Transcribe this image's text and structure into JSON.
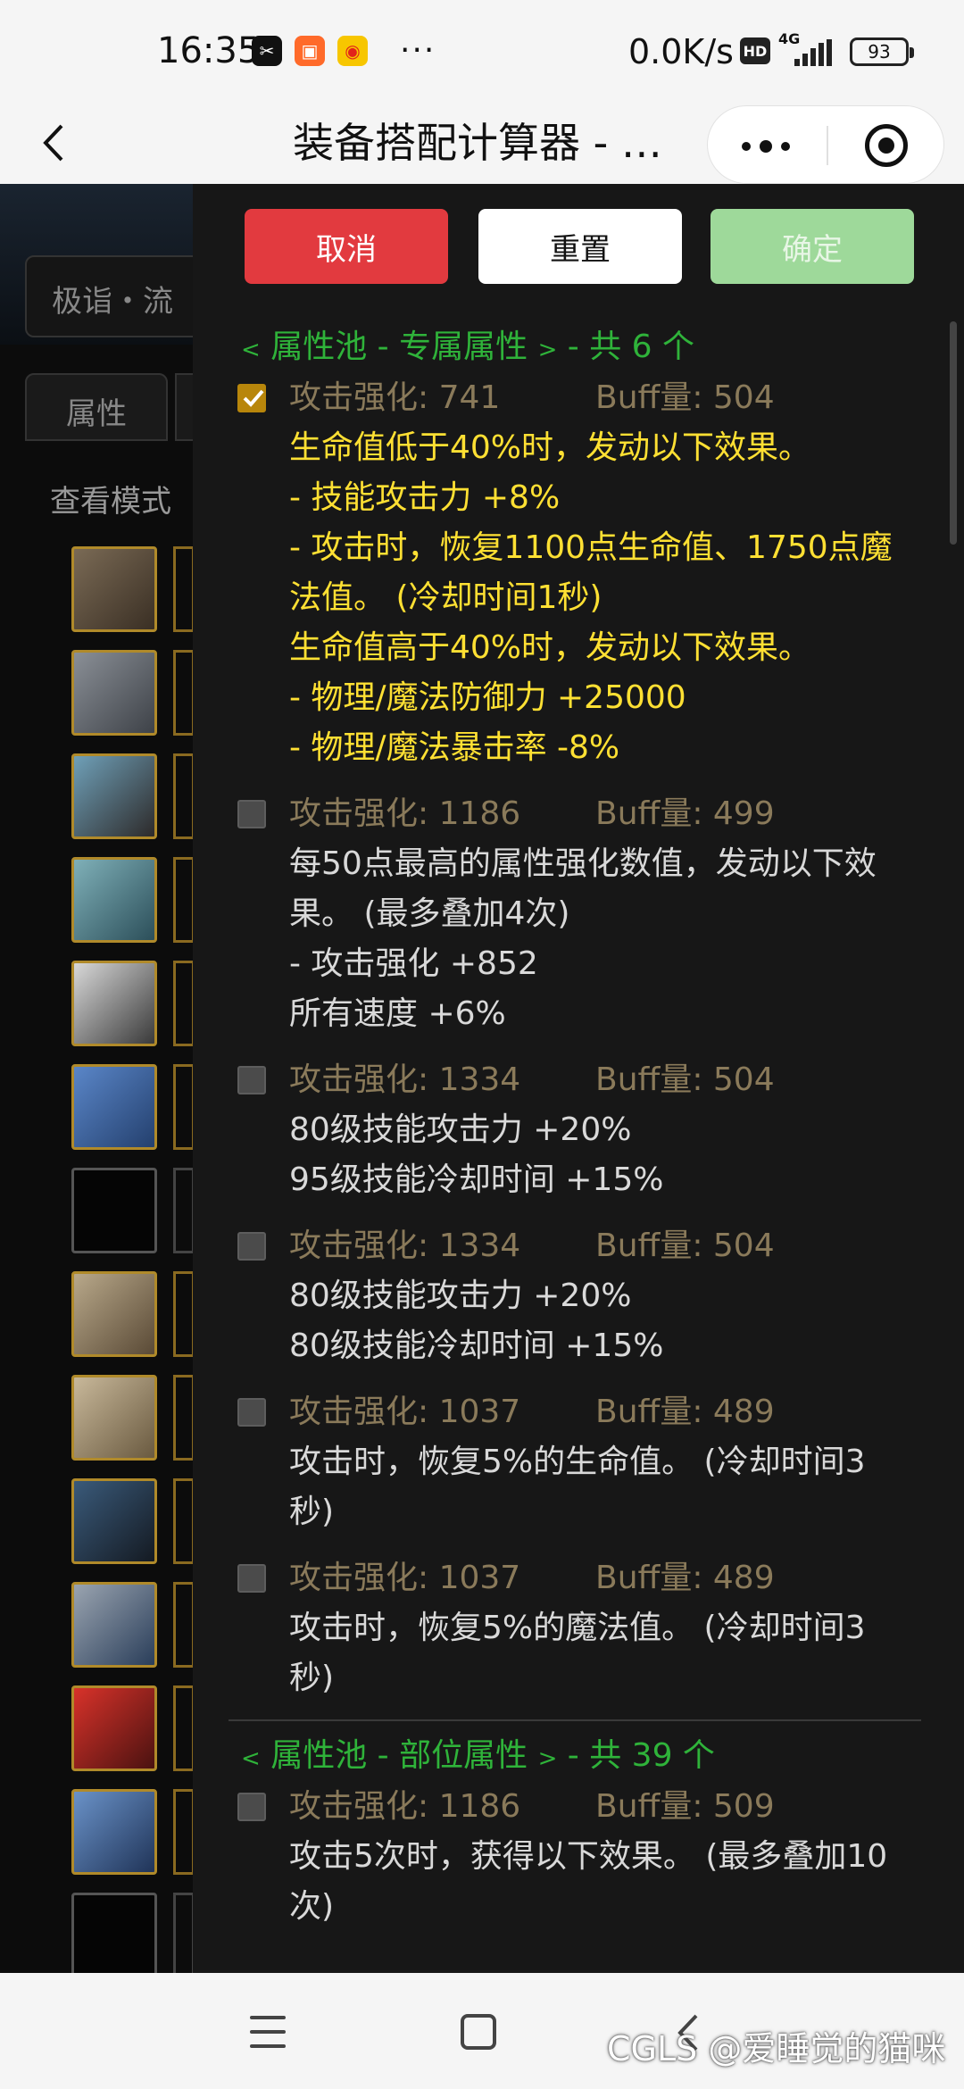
{
  "status_bar": {
    "time": "16:35",
    "network_speed": "0.0K/s",
    "hd": "HD",
    "net_type": "4G",
    "battery": "93",
    "more": "···"
  },
  "title_bar": {
    "title": "装备搭配计算器 - …"
  },
  "background": {
    "input_text": "极诣・流",
    "tab_label": "属性",
    "mode_label": "查看模式"
  },
  "buttons": {
    "cancel": "取消",
    "reset": "重置",
    "confirm": "确定"
  },
  "sections": [
    {
      "title_prefix": "<",
      "title": " 属性池 - 专属属性 ",
      "title_suffix": ">",
      "count": " - 共 6 个",
      "options": [
        {
          "checked": true,
          "attack": "攻击强化: 741",
          "buff": "Buff量: 504",
          "effects": [
            "生命值低于40%时，发动以下效果。",
            "- 技能攻击力 +8%",
            "- 攻击时，恢复1100点生命值、1750点魔",
            "法值。 (冷却时间1秒)",
            "生命值高于40%时，发动以下效果。",
            "- 物理/魔法防御力 +25000",
            "- 物理/魔法暴击率 -8%"
          ]
        },
        {
          "checked": false,
          "attack": "攻击强化: 1186",
          "buff": "Buff量: 499",
          "effects": [
            "每50点最高的属性强化数值，发动以下效",
            "果。 (最多叠加4次)",
            "- 攻击强化 +852",
            "所有速度 +6%"
          ]
        },
        {
          "checked": false,
          "attack": "攻击强化: 1334",
          "buff": "Buff量: 504",
          "effects": [
            "80级技能攻击力 +20%",
            "95级技能冷却时间 +15%"
          ]
        },
        {
          "checked": false,
          "attack": "攻击强化: 1334",
          "buff": "Buff量: 504",
          "effects": [
            "80级技能攻击力 +20%",
            "80级技能冷却时间 +15%"
          ]
        },
        {
          "checked": false,
          "attack": "攻击强化: 1037",
          "buff": "Buff量: 489",
          "effects": [
            "攻击时，恢复5%的生命值。 (冷却时间3",
            "秒)"
          ]
        },
        {
          "checked": false,
          "attack": "攻击强化: 1037",
          "buff": "Buff量: 489",
          "effects": [
            "攻击时，恢复5%的魔法值。 (冷却时间3",
            "秒)"
          ]
        }
      ]
    },
    {
      "title_prefix": "<",
      "title": " 属性池 - 部位属性 ",
      "title_suffix": ">",
      "count": " - 共 39 个",
      "options": [
        {
          "checked": false,
          "attack": "攻击强化: 1186",
          "buff": "Buff量: 509",
          "effects": [
            "攻击5次时，获得以下效果。 (最多叠加10",
            "次)"
          ]
        }
      ]
    }
  ],
  "watermark": "CGLS @爱睡觉的猫咪",
  "colors": {
    "cancel": "#e23a3f",
    "confirm": "#9ed99a",
    "section_title": "#2fb33a",
    "active_effect": "#ffe033",
    "stats": "#8a7a5a"
  }
}
